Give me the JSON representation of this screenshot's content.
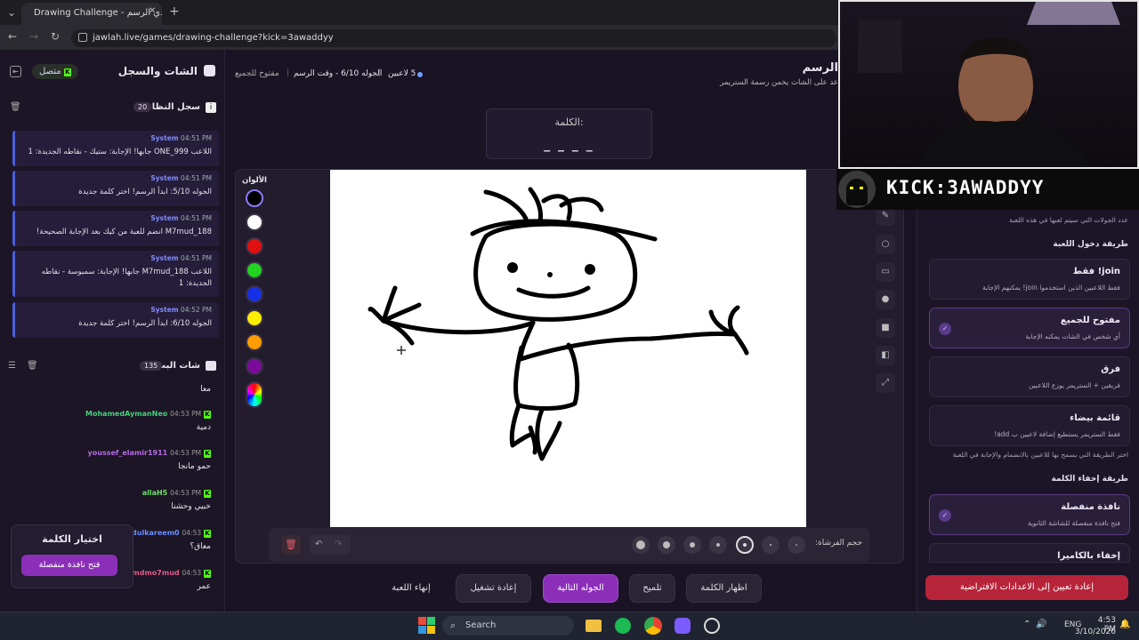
{
  "browser": {
    "tab_title": "Drawing Challenge - تحدي الرسم",
    "url": "jawlah.live/games/drawing-challenge?kick=3awaddyy"
  },
  "left_panel": {
    "title": "الشات والسجل",
    "status": "متصل",
    "system_log": {
      "title": "سجل النظام",
      "count": "20",
      "messages": [
        {
          "sender": "System",
          "time": "04:51 PM",
          "text": "اللاعب ONE_999 جابها! الإجابة: ستيك - نقاطه الجديدة: 1"
        },
        {
          "sender": "System",
          "time": "04:51 PM",
          "text": "الجوله 5/10: ابدأ الرسم! اختر كلمة جديدة"
        },
        {
          "sender": "System",
          "time": "04:51 PM",
          "text": "M7mud_188 انضم للعبة من كيك بعد الإجابة الصحيحة!"
        },
        {
          "sender": "System",
          "time": "04:51 PM",
          "text": "اللاعب M7mud_188 جابها! الإجابة: سمبوسة - نقاطه الجديدة: 1"
        },
        {
          "sender": "System",
          "time": "04:52 PM",
          "text": "الجوله 6/10: ابدأ الرسم! اختر كلمة جديدة"
        }
      ]
    },
    "live_chat": {
      "title": "شات البث",
      "count": "135",
      "messages": [
        {
          "name": "",
          "time": "",
          "text": "معا",
          "color": "#e8e4ee"
        },
        {
          "name": "MohamedAymanNeo",
          "time": "04:53 PM",
          "text": "دمية",
          "color": "#44d17a"
        },
        {
          "name": "youssef_elamir1911",
          "time": "04:53 PM",
          "text": "حمو مانجا",
          "color": "#b36ae0"
        },
        {
          "name": "allaH5",
          "time": "04:53 PM",
          "text": "خبيي وحشنا",
          "color": "#6fe06a"
        },
        {
          "name": "0Abdulkareem0",
          "time": "04:53",
          "text": "معاق؟",
          "color": "#6a8cff"
        },
        {
          "name": "x7mdmo7mud",
          "time": "04:53",
          "text": "عمر",
          "color": "#e05a8a"
        }
      ]
    },
    "word_picker": {
      "title": "اختيار الكلمة",
      "button": "فتح نافذة منفصلة"
    }
  },
  "game": {
    "title": "الرسم",
    "subtitle": "عد على الشات يخمن رسمة الستريمر",
    "info": {
      "players": "5 لاعبين",
      "round": "الجوله 6/10 - وقت الرسم",
      "mode": "مفتوح للجميع"
    },
    "word_label": "الكلمة:",
    "word_mask": "_ _ _ _",
    "colors_label": "الألوان",
    "colors": [
      "#000000",
      "#ffffff",
      "#e01010",
      "#22d322",
      "#1530e6",
      "#ffee00",
      "#ff9d00",
      "#7a0a9a"
    ],
    "brush_label": "حجم الفرشاة:",
    "actions": {
      "end_game": "إنهاء اللعبة",
      "restart": "إعادة تشغيل",
      "next_round": "الجوله التالية",
      "hint": "تلميح",
      "show_word": "اظهار الكلمة"
    }
  },
  "settings": {
    "rounds_note": "عدد الجولات التي سيتم لعبها في هذه اللعبة",
    "entry_title": "طريقة دخول اللعبة",
    "entry_options": [
      {
        "title": "join! فقط",
        "desc": "فقط اللاعبين الذين استخدموا join! يمكنهم الإجابة",
        "selected": false
      },
      {
        "title": "مفتوح للجميع",
        "desc": "أي شخص في الشات يمكنه الإجابة",
        "selected": true
      },
      {
        "title": "فرق",
        "desc": "فريقين + الستريمر يوزع اللاعبين",
        "selected": false
      },
      {
        "title": "قائمة بيضاء",
        "desc": "فقط الستريمر يستطيع إضافة لاعبين ب add!",
        "selected": false
      }
    ],
    "entry_note": "اختر الطريقة التي يسمح بها للاعبين بالانضمام والإجابة في اللعبة",
    "hide_title": "طريقة إخفاء الكلمة",
    "hide_options": [
      {
        "title": "نافذة منفصلة",
        "desc": "فتح نافذة منفصلة للشاشة الثانوية",
        "selected": true
      },
      {
        "title": "إخفاء بالكاميرا",
        "desc": "",
        "selected": false
      }
    ],
    "reset_button": "إعادة تعيين إلى الاعدادات الافتراضية"
  },
  "stream": {
    "banner": "KICK:3AWADDYY"
  },
  "taskbar": {
    "search_placeholder": "Search",
    "lang": "ENG",
    "time": "4:53 PM",
    "date": "3/10/2026"
  }
}
